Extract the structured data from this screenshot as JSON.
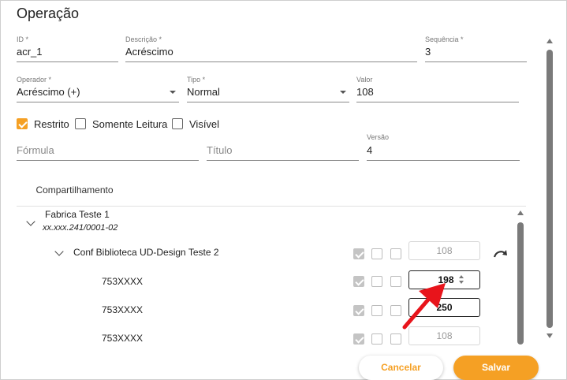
{
  "dialog": {
    "title": "Operação"
  },
  "fields": {
    "id": {
      "label": "ID *",
      "value": "acr_1"
    },
    "descricao": {
      "label": "Descrição *",
      "value": "Acréscimo"
    },
    "sequencia": {
      "label": "Sequência *",
      "value": "3"
    },
    "operador": {
      "label": "Operador *",
      "value": "Acréscimo (+)"
    },
    "tipo": {
      "label": "Tipo *",
      "value": "Normal"
    },
    "valor": {
      "label": "Valor",
      "value": "108"
    },
    "formula": {
      "placeholder": "Fórmula"
    },
    "titulo": {
      "placeholder": "Título"
    },
    "versao": {
      "label": "Versão",
      "value": "4"
    }
  },
  "checkboxes": {
    "restrito": {
      "label": "Restrito",
      "checked": true
    },
    "somente_leitura": {
      "label": "Somente Leitura",
      "checked": false
    },
    "visivel": {
      "label": "Visível",
      "checked": false
    }
  },
  "tabs": {
    "compartilhamento": "Compartilhamento"
  },
  "tree": {
    "root": {
      "name": "Fabrica Teste 1",
      "doc": "xx.xxx.241/0001-02"
    },
    "group": {
      "name": "Conf Biblioteca UD-Design Teste 2",
      "value": "108"
    },
    "items": [
      {
        "name": "753XXXX",
        "value": "198"
      },
      {
        "name": "753XXXX",
        "value": "250"
      },
      {
        "name": "753XXXX",
        "value": "108"
      }
    ]
  },
  "buttons": {
    "cancel": "Cancelar",
    "save": "Salvar"
  },
  "colors": {
    "accent": "#f5a024",
    "annotation_arrow": "#e8141b"
  }
}
